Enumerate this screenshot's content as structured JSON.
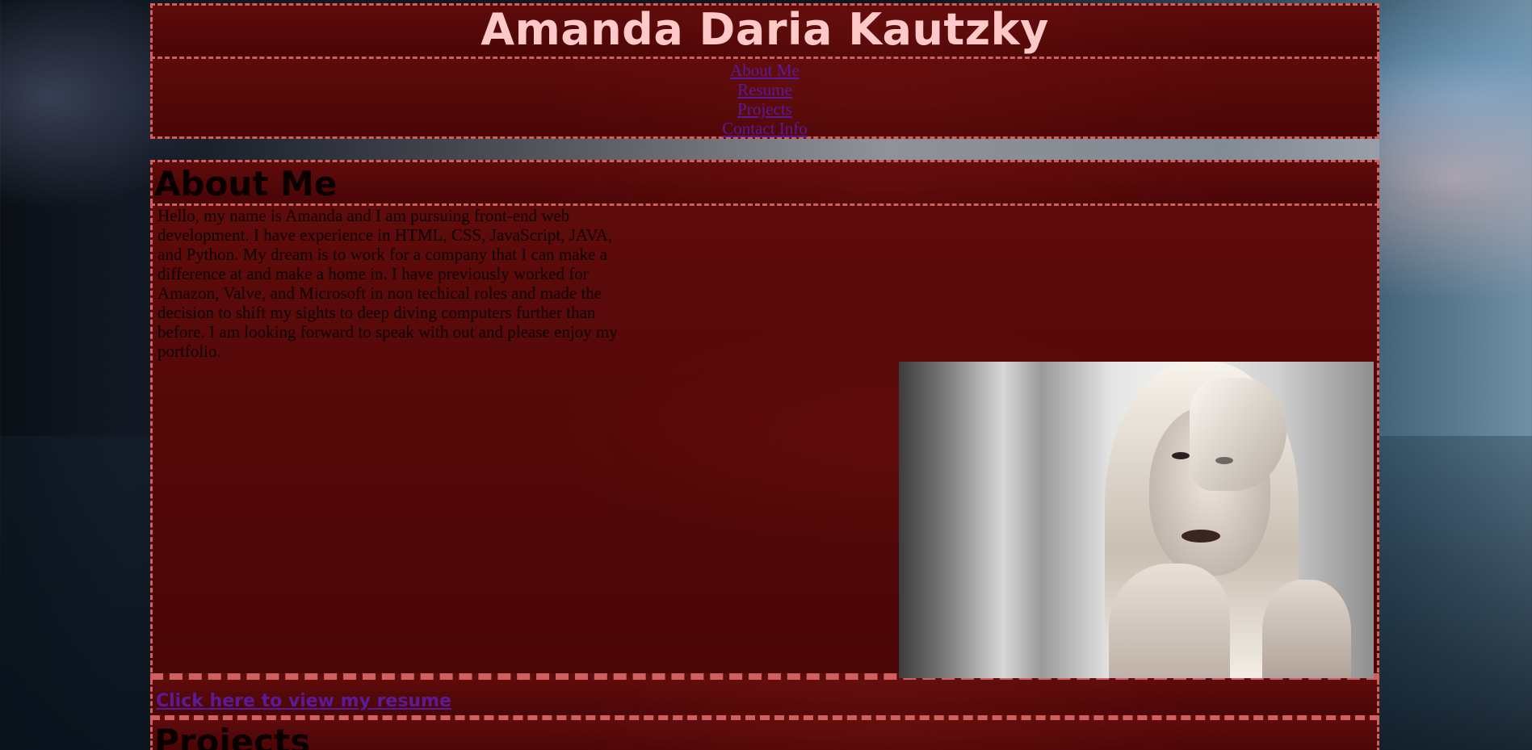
{
  "header": {
    "title": "Amanda Daria Kautzky"
  },
  "nav": {
    "items": [
      {
        "label": "About Me"
      },
      {
        "label": "Resume"
      },
      {
        "label": "Projects"
      },
      {
        "label": "Contact Info"
      }
    ]
  },
  "about": {
    "heading": "About Me",
    "text": "Hello, my name is Amanda and I am pursuing front-end web development. I have experience in HTML, CSS, JavaScript, JAVA, and Python. My dream is to work for a company that I can make a difference at and make a home in. I have previously worked for Amazon, Valve, and Microsoft in non techical roles and made the decision to shift my sights to deep diving computers further than before. I am looking forward to speak with out and please enjoy my portfolio."
  },
  "resume": {
    "link_label": "Click here to view my resume"
  },
  "projects": {
    "heading": "Projects"
  },
  "colors": {
    "title": "#ffc9c9",
    "link": "#5b1a9a",
    "border": "#d06060",
    "panel": "#550808"
  }
}
